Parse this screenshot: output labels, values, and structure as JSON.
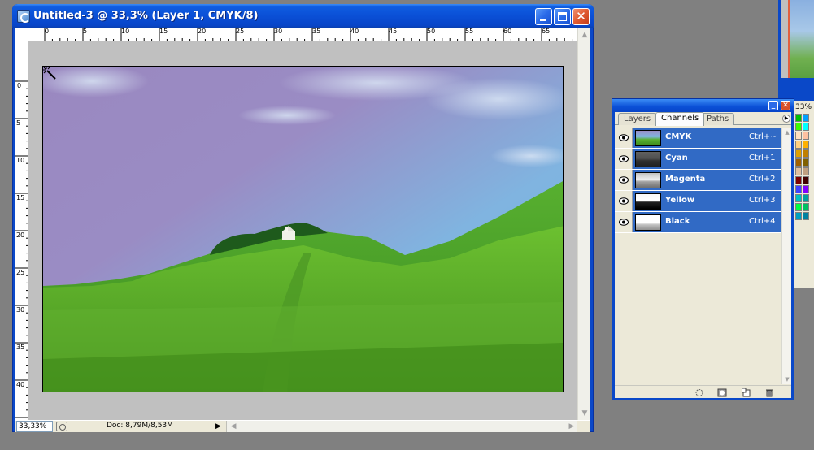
{
  "document_window": {
    "title": "Untitled-3 @ 33,3% (Layer 1, CMYK/8)",
    "controls": {
      "minimize_icon": "minimize-icon",
      "maximize_icon": "maximize-icon",
      "close_icon": "close-icon"
    },
    "horizontal_ruler": {
      "labels": [
        "0",
        "5",
        "10",
        "15",
        "20",
        "25",
        "30",
        "35",
        "40",
        "45",
        "50",
        "55",
        "60",
        "65"
      ]
    },
    "vertical_ruler": {
      "labels": [
        "0",
        "5",
        "10",
        "15",
        "20",
        "25",
        "30",
        "35",
        "40"
      ]
    },
    "status_bar": {
      "zoom": "33,33%",
      "doc_info": "Doc: 8,79M/8,53M"
    }
  },
  "palette": {
    "tabs": [
      {
        "label": "Layers",
        "active": false
      },
      {
        "label": "Channels",
        "active": true
      },
      {
        "label": "Paths",
        "active": false
      }
    ],
    "channels": [
      {
        "name": "CMYK",
        "shortcut": "Ctrl+~",
        "thumb": "color"
      },
      {
        "name": "Cyan",
        "shortcut": "Ctrl+1",
        "thumb": "cyan"
      },
      {
        "name": "Magenta",
        "shortcut": "Ctrl+2",
        "thumb": "magenta"
      },
      {
        "name": "Yellow",
        "shortcut": "Ctrl+3",
        "thumb": "yellow"
      },
      {
        "name": "Black",
        "shortcut": "Ctrl+4",
        "thumb": "black"
      }
    ],
    "footer_icons": [
      "load-channel-as-selection-icon",
      "save-selection-as-channel-icon",
      "new-channel-icon",
      "delete-channel-icon"
    ]
  },
  "right_panel": {
    "zoom_label": "33%",
    "swatch_colors": [
      "#00c000",
      "#00a0ff",
      "#40ff00",
      "#00ffff",
      "#ffe0c0",
      "#ffc0a0",
      "#ffd080",
      "#ffb000",
      "#e0a000",
      "#c08000",
      "#a06000",
      "#806000",
      "#e0c0a0",
      "#c0a080",
      "#800000",
      "#400000",
      "#4040ff",
      "#8000ff",
      "#00c0c0",
      "#00a0a0",
      "#00ff40",
      "#00c060",
      "#00a0c0",
      "#0080a0"
    ]
  },
  "colors": {
    "xp_blue": "#0a48c8",
    "selection_blue": "#316ac5",
    "panel_bg": "#ece9d8",
    "canvas_gray": "#c0c0c0"
  }
}
